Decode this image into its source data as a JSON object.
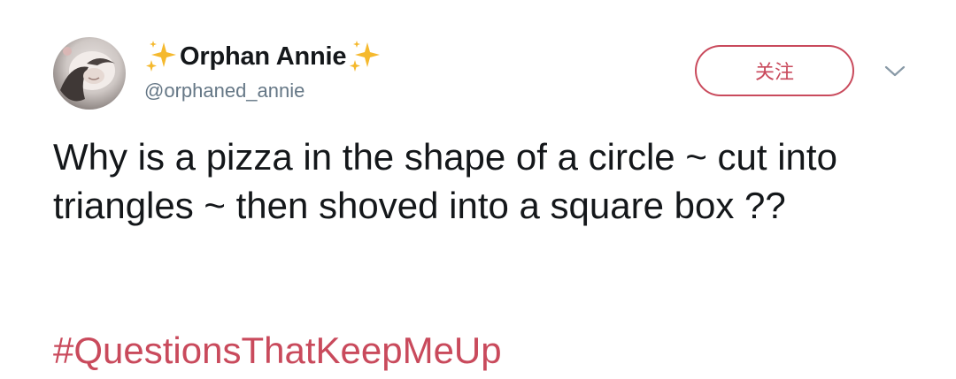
{
  "user": {
    "display_name": "Orphan Annie",
    "handle": "@orphaned_annie",
    "name_decoration_icon": "sparkles-icon"
  },
  "actions": {
    "follow_label": "关注",
    "menu_icon": "chevron-down-icon"
  },
  "tweet": {
    "text": "Why is a pizza in the shape of a circle ~ cut into triangles ~ then shoved into a square box ??",
    "hashtag": "#QuestionsThatKeepMeUp"
  },
  "colors": {
    "accent": "#c94a5c",
    "text": "#14171a",
    "muted": "#657786",
    "sparkle": "#f5b92e"
  }
}
